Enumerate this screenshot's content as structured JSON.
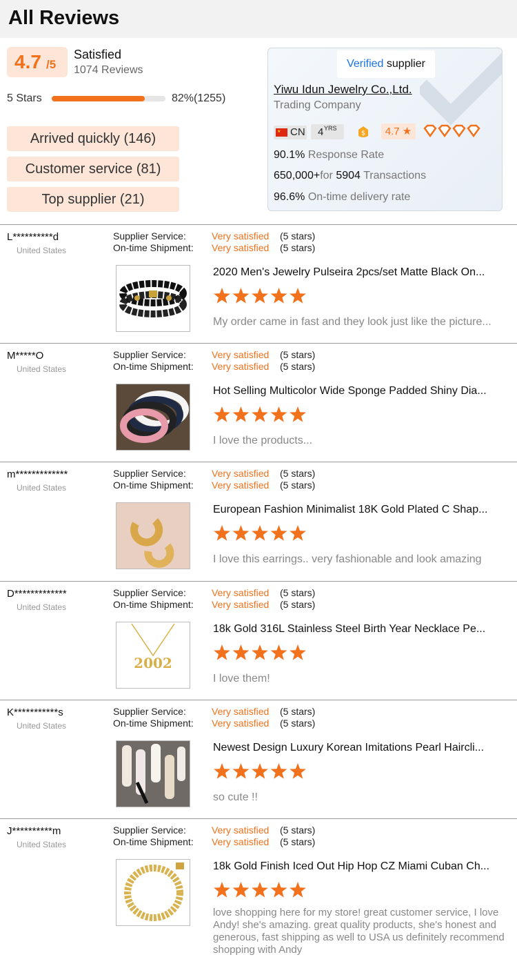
{
  "header": {
    "title": "All Reviews"
  },
  "summary": {
    "score": "4.7",
    "score_max": "/5",
    "label": "Satisfied",
    "count_text": "1074 Reviews",
    "stars_label": "5 Stars",
    "stars_fraction": 0.82,
    "stars_pct_text": "82%(1255)",
    "tags": [
      "Arrived quickly (146)",
      "Customer service (81)",
      "Top supplier (21)"
    ]
  },
  "supplier": {
    "badge_verified": "Verified",
    "badge_supplier": "supplier",
    "company": "Yiwu Idun Jewelry Co.,Ltd.",
    "type": "Trading Company",
    "country": "CN",
    "years_num": "4",
    "years_unit": "YRS",
    "rating": "4.7 ★",
    "diamond_count": 4,
    "response_value": "90.1%",
    "response_label": "Response Rate",
    "transactions_value": "650,000+",
    "transactions_for": "for",
    "transactions_count": "5904",
    "transactions_label": "Transactions",
    "ontime_value": "96.6%",
    "ontime_label": "On-time delivery rate"
  },
  "review_labels": {
    "supplier_service": "Supplier Service:",
    "ontime_shipment": "On-time Shipment:",
    "value": "Very satisfied",
    "stars_text": "(5 stars)"
  },
  "reviews": [
    {
      "name": "L**********d",
      "country": "United States",
      "product": "2020 Men's Jewelry Pulseira 2pcs/set Matte Black On...",
      "rating": 5,
      "text": "My order came in fast and they look just like the picture..."
    },
    {
      "name": "M*****O",
      "country": "United States",
      "product": "Hot Selling Multicolor Wide Sponge Padded Shiny Dia...",
      "rating": 5,
      "text": "I love the products..."
    },
    {
      "name": "m*************",
      "country": "United States",
      "product": "European Fashion Minimalist 18K Gold Plated C Shap...",
      "rating": 5,
      "text": "I love this earrings.. very fashionable and look amazing"
    },
    {
      "name": "D*************",
      "country": "United States",
      "product": "18k Gold 316L Stainless Steel Birth Year Necklace Pe...",
      "rating": 5,
      "text": "I love them!"
    },
    {
      "name": "K***********s",
      "country": "United States",
      "product": "Newest Design Luxury Korean Imitations Pearl Haircli...",
      "rating": 5,
      "text": "so cute !!"
    },
    {
      "name": "J**********m",
      "country": "United States",
      "product": "18k Gold Finish Iced Out Hip Hop CZ Miami Cuban Ch...",
      "rating": 5,
      "text": "love shopping here for my store! great customer service, I love Andy! she's amazing. great quality products, she's honest and generous, fast shipping as well to USA us  definitely recommend shopping with Andy"
    }
  ],
  "colors": {
    "accent": "#f2711c",
    "accent_bg": "#fde6d8",
    "verified_blue": "#1a73e8"
  }
}
